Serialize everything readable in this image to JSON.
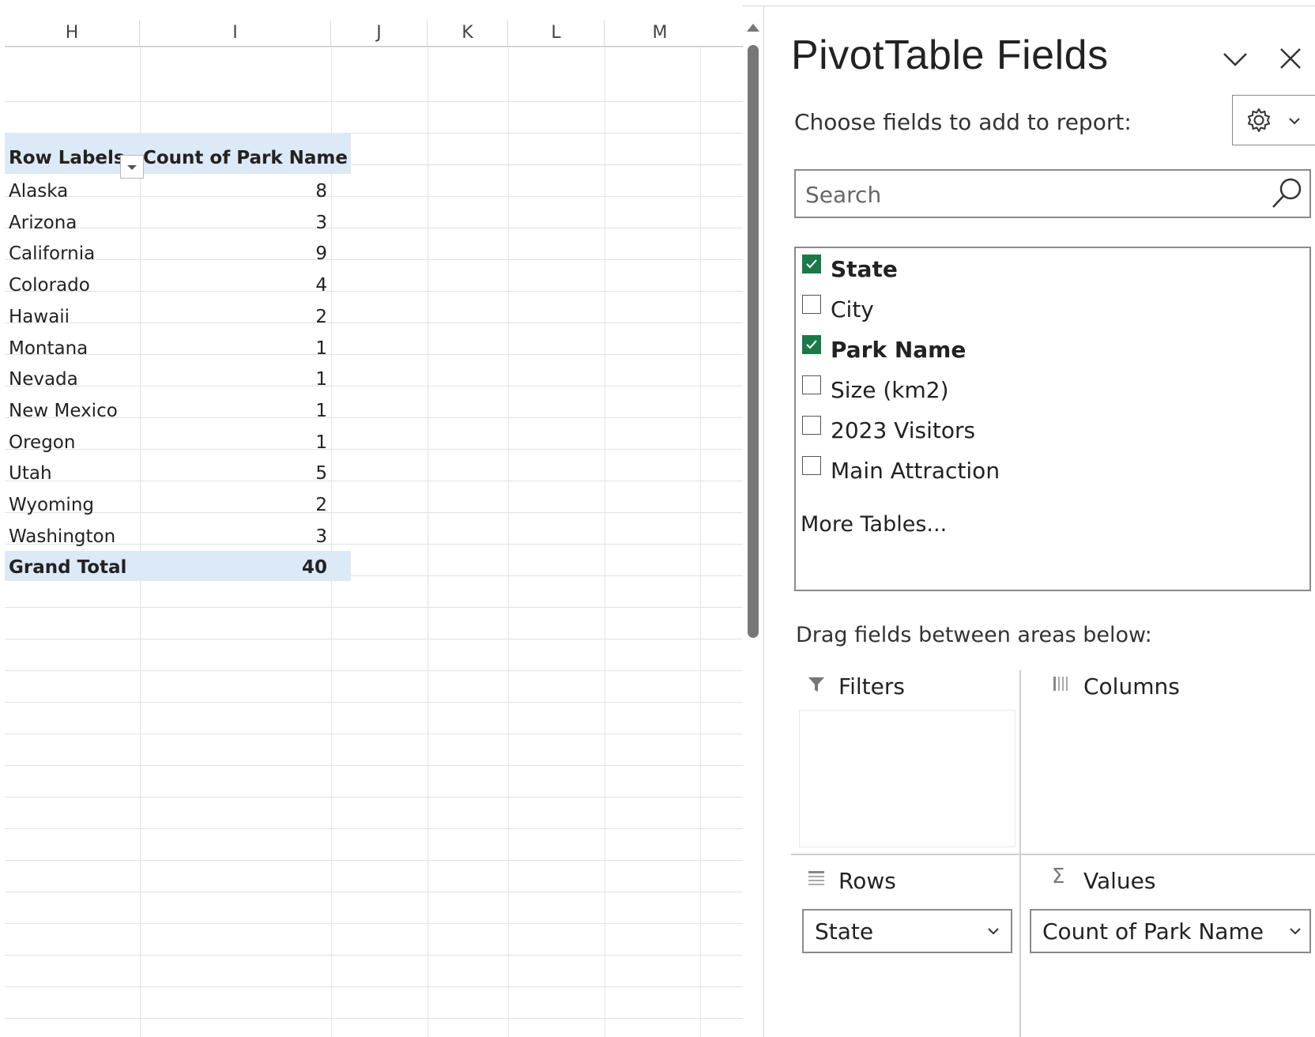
{
  "sheet": {
    "columns": [
      "H",
      "I",
      "J",
      "K",
      "L",
      "M"
    ],
    "pivot": {
      "header_row_label": "Row Labels",
      "header_value_label": "Count of Park Name",
      "rows": [
        {
          "label": "Alaska",
          "value": "8"
        },
        {
          "label": "Arizona",
          "value": "3"
        },
        {
          "label": "California",
          "value": "9"
        },
        {
          "label": "Colorado",
          "value": "4"
        },
        {
          "label": "Hawaii",
          "value": "2"
        },
        {
          "label": "Montana",
          "value": "1"
        },
        {
          "label": "Nevada",
          "value": "1"
        },
        {
          "label": "New Mexico",
          "value": "1"
        },
        {
          "label": "Oregon",
          "value": "1"
        },
        {
          "label": "Utah",
          "value": "5"
        },
        {
          "label": "Wyoming",
          "value": "2"
        },
        {
          "label": "Washington",
          "value": "3"
        }
      ],
      "total_label": "Grand Total",
      "total_value": "40"
    }
  },
  "pane": {
    "title": "PivotTable Fields",
    "choose_label": "Choose fields to add to report:",
    "search_placeholder": "Search",
    "fields": [
      {
        "label": "State",
        "checked": true
      },
      {
        "label": "City",
        "checked": false
      },
      {
        "label": "Park Name",
        "checked": true
      },
      {
        "label": "Size (km2)",
        "checked": false
      },
      {
        "label": "2023  Visitors",
        "checked": false
      },
      {
        "label": "Main Attraction",
        "checked": false
      }
    ],
    "more_tables": "More Tables...",
    "drag_label": "Drag fields between areas below:",
    "areas": {
      "filters": "Filters",
      "columns": "Columns",
      "rows": "Rows",
      "values": "Values",
      "rows_item": "State",
      "values_item": "Count of Park Name"
    },
    "accent_color": "#1a7a46"
  }
}
